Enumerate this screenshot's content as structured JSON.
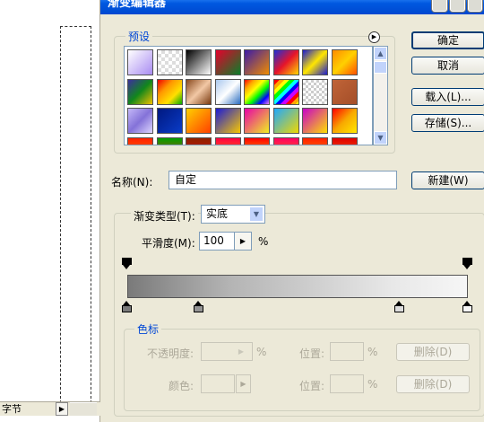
{
  "dialog": {
    "title": "渐变编辑器",
    "presets_label": "预设",
    "name_label": "名称(N):",
    "name_value": "自定",
    "gradient_type_label": "渐变类型(T):",
    "gradient_type_value": "实底",
    "smoothness_label": "平滑度(M):",
    "smoothness_value": "100",
    "smoothness_unit": "%"
  },
  "buttons": {
    "ok": "确定",
    "cancel": "取消",
    "load": "载入(L)...",
    "save": "存储(S)...",
    "new": "新建(W)"
  },
  "stops_group": {
    "label": "色标",
    "opacity_label": "不透明度:",
    "opacity_unit": "%",
    "location_label_1": "位置:",
    "location_unit_1": "%",
    "delete_label_1": "删除(D)",
    "color_label": "颜色:",
    "location_label_2": "位置:",
    "location_unit_2": "%",
    "delete_label_2": "删除(D)"
  },
  "left_panel": {
    "tab_label": "字节"
  },
  "gradient": {
    "color_stop_positions_pct": [
      0,
      21,
      80,
      100
    ],
    "opacity_stop_positions_pct": [
      0,
      100
    ]
  },
  "presets": [
    {
      "name": "preset-1",
      "css": "linear-gradient(135deg,#fff,#a98cf2)"
    },
    {
      "name": "preset-2",
      "css": "repeating-conic-gradient(#ddd 0 25%,#fff 0 50%) 0 0/8px 8px"
    },
    {
      "name": "preset-3",
      "css": "linear-gradient(135deg,#000,#fff)"
    },
    {
      "name": "preset-4",
      "css": "linear-gradient(135deg,#e6002b,#0a7e2a)"
    },
    {
      "name": "preset-5",
      "css": "linear-gradient(135deg,#3b1aa8,#f08c00)"
    },
    {
      "name": "preset-6",
      "css": "linear-gradient(135deg,#1d2fd8,#e6142a,#ffd800)"
    },
    {
      "name": "preset-7",
      "css": "linear-gradient(135deg,#1a1ad0,#ffe600,#1a1ad0)"
    },
    {
      "name": "preset-8",
      "css": "linear-gradient(135deg,#ff8a00,#ffd000,#ff5000)"
    },
    {
      "name": "preset-9",
      "css": "linear-gradient(135deg,#3c2f9e,#11871c,#f0c000)"
    },
    {
      "name": "preset-10",
      "css": "linear-gradient(135deg,#e00,#ff9800,#ffe000,#0a0)"
    },
    {
      "name": "preset-11",
      "css": "linear-gradient(135deg,#8a4a1f,#f2c8a5,#7a3a10)"
    },
    {
      "name": "preset-12",
      "css": "linear-gradient(135deg,#a9c8ee,#fff,#2a6cc0)"
    },
    {
      "name": "preset-13",
      "css": "linear-gradient(135deg,red,orange,yellow,lime,blue,violet)"
    },
    {
      "name": "preset-14",
      "css": "repeating-linear-gradient(135deg,red 0 4px,orange 4px 8px,yellow 8px 12px,lime 12px 16px,cyan 16px 20px,#00f 20px 24px,#c0f 24px 28px)"
    },
    {
      "name": "preset-15",
      "css": "repeating-conic-gradient(#ccc 0 25%,#fff 0 50%) 0 0/6px 6px"
    },
    {
      "name": "preset-16",
      "css": "linear-gradient(135deg,#c06438,#a44e28)"
    },
    {
      "name": "preset-17",
      "css": "linear-gradient(135deg,#c4b8f8,#8472d8,#ddd6ff)"
    },
    {
      "name": "preset-18",
      "css": "linear-gradient(135deg,#001880,#0a3cc8)"
    },
    {
      "name": "preset-19",
      "css": "linear-gradient(135deg,#ffd000,#ff4000)"
    },
    {
      "name": "preset-20",
      "css": "linear-gradient(135deg,#1a1ad8,#f8c800)"
    },
    {
      "name": "preset-21",
      "css": "linear-gradient(135deg,#e800a8,#f0f020)"
    },
    {
      "name": "preset-22",
      "css": "linear-gradient(135deg,#1fa8ff,#f0d800)"
    },
    {
      "name": "preset-23",
      "css": "linear-gradient(135deg,#c800c8,#ffe000)"
    },
    {
      "name": "preset-24",
      "css": "linear-gradient(135deg,#f00,#f8a800,#ffe800)"
    },
    {
      "name": "preset-25",
      "css": "linear-gradient(#ff2000,#ff8800)"
    },
    {
      "name": "preset-26",
      "css": "linear-gradient(#00a000,#ff2000)"
    },
    {
      "name": "preset-27",
      "css": "linear-gradient(#902000,#e01000)"
    },
    {
      "name": "preset-28",
      "css": "linear-gradient(#ff0040,#ffa000)"
    },
    {
      "name": "preset-29",
      "css": "linear-gradient(#ff0000,#ffe000)"
    },
    {
      "name": "preset-30",
      "css": "linear-gradient(#ff0060,#ff9000)"
    },
    {
      "name": "preset-31",
      "css": "linear-gradient(#ff2000,#ffa000)"
    },
    {
      "name": "preset-32",
      "css": "linear-gradient(#e00000,#ff7000)"
    }
  ]
}
